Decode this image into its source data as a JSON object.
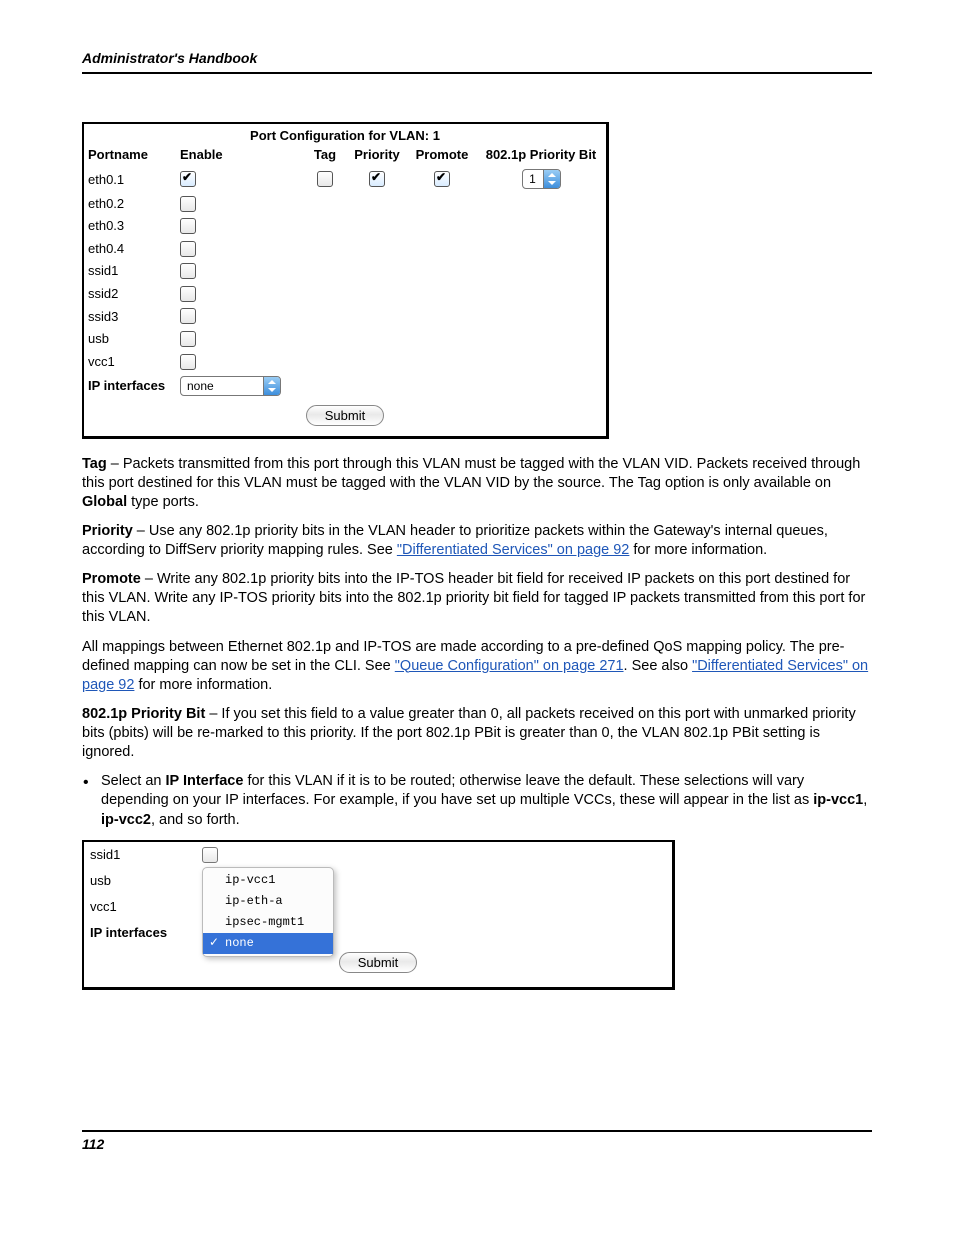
{
  "header": {
    "title": "Administrator's Handbook"
  },
  "panel1": {
    "title": "Port Configuration for VLAN: 1",
    "columns": {
      "portname": "Portname",
      "enable": "Enable",
      "tag": "Tag",
      "priority": "Priority",
      "promote": "Promote",
      "pbit": "802.1p Priority Bit"
    },
    "rows": [
      {
        "name": "eth0.1",
        "enable": true,
        "tag": false,
        "priority": true,
        "promote": true,
        "pbit": "1",
        "extras": true
      },
      {
        "name": "eth0.2",
        "enable": false
      },
      {
        "name": "eth0.3",
        "enable": false
      },
      {
        "name": "eth0.4",
        "enable": false
      },
      {
        "name": "ssid1",
        "enable": false
      },
      {
        "name": "ssid2",
        "enable": false
      },
      {
        "name": "ssid3",
        "enable": false
      },
      {
        "name": "usb",
        "enable": false
      },
      {
        "name": "vcc1",
        "enable": false
      }
    ],
    "ip_interfaces_label": "IP interfaces",
    "ip_interfaces_value": "none",
    "submit": "Submit"
  },
  "paragraphs": {
    "tag": {
      "lead": "Tag",
      "text1": " – Packets transmitted from this port through this VLAN must be tagged with the VLAN VID. Packets received through this port destined for this VLAN must be tagged with the VLAN VID by the source. The Tag option is only available on ",
      "bold": "Global",
      "text2": " type ports."
    },
    "priority": {
      "lead": "Priority",
      "text1": " – Use any 802.1p priority bits in the VLAN header to prioritize packets within the Gateway's internal queues, according to DiffServ priority mapping rules. See ",
      "link": "\"Differentiated Services\" on page 92",
      "text2": " for more information."
    },
    "promote": {
      "lead": "Promote",
      "text": " – Write any 802.1p priority bits into the IP-TOS header bit field for received IP packets on this port destined for this VLAN. Write any IP-TOS priority bits into the 802.1p priority bit field for tagged IP packets transmitted from this port for this VLAN."
    },
    "mapping": {
      "text1": "All mappings between Ethernet 802.1p and IP-TOS are made according to a pre-defined QoS mapping policy. The pre-defined mapping can now be set in the CLI. See ",
      "link1": "\"Queue Configuration\" on page 271",
      "text2": ". See also ",
      "link2": "\"Differentiated Services\" on page 92",
      "text3": " for more information."
    },
    "pbit": {
      "lead": "802.1p Priority Bit",
      "text": " – If you set this field to a value greater than 0, all packets received on this port with unmarked priority bits (pbits) will be re-marked to this priority. If the port 802.1p PBit is greater than 0, the VLAN 802.1p PBit setting is ignored."
    },
    "bullet": {
      "text1": "Select an ",
      "b1": "IP Interface",
      "text2": " for this VLAN if it is to be routed; otherwise leave the default. These selections will vary depending on your IP interfaces. For example, if you have set up multiple VCCs, these will appear in the list as ",
      "b2": "ip-vcc1",
      "sep": ", ",
      "b3": "ip-vcc2",
      "text3": ", and so forth."
    }
  },
  "panel2": {
    "rows": [
      {
        "label": "ssid1",
        "checkbox": true
      },
      {
        "label": "usb",
        "checkbox": true
      },
      {
        "label": "vcc1",
        "checkbox": true
      }
    ],
    "ip_label": "IP interfaces",
    "dropdown_options": [
      "ip-vcc1",
      "ip-eth-a",
      "ipsec-mgmt1",
      "none"
    ],
    "dropdown_selected": "none",
    "submit": "Submit"
  },
  "footer": {
    "page_number": "112"
  }
}
